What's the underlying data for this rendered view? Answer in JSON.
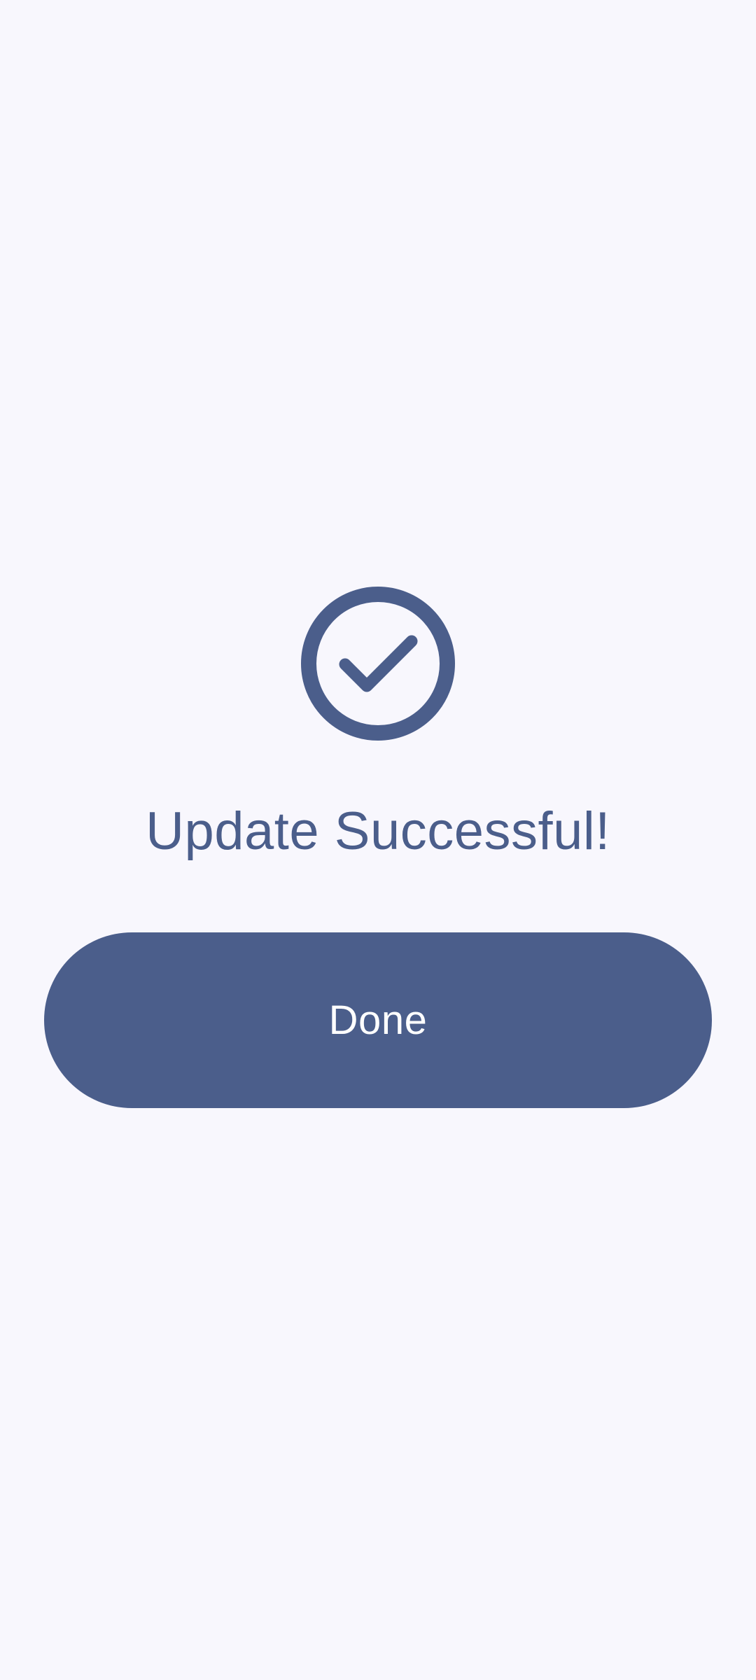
{
  "status": {
    "icon": "check-circle-icon",
    "message": "Update Successful!"
  },
  "actions": {
    "done_label": "Done"
  },
  "colors": {
    "background": "#f8f7fd",
    "accent": "#4b5e8b",
    "button_text": "#ffffff"
  }
}
